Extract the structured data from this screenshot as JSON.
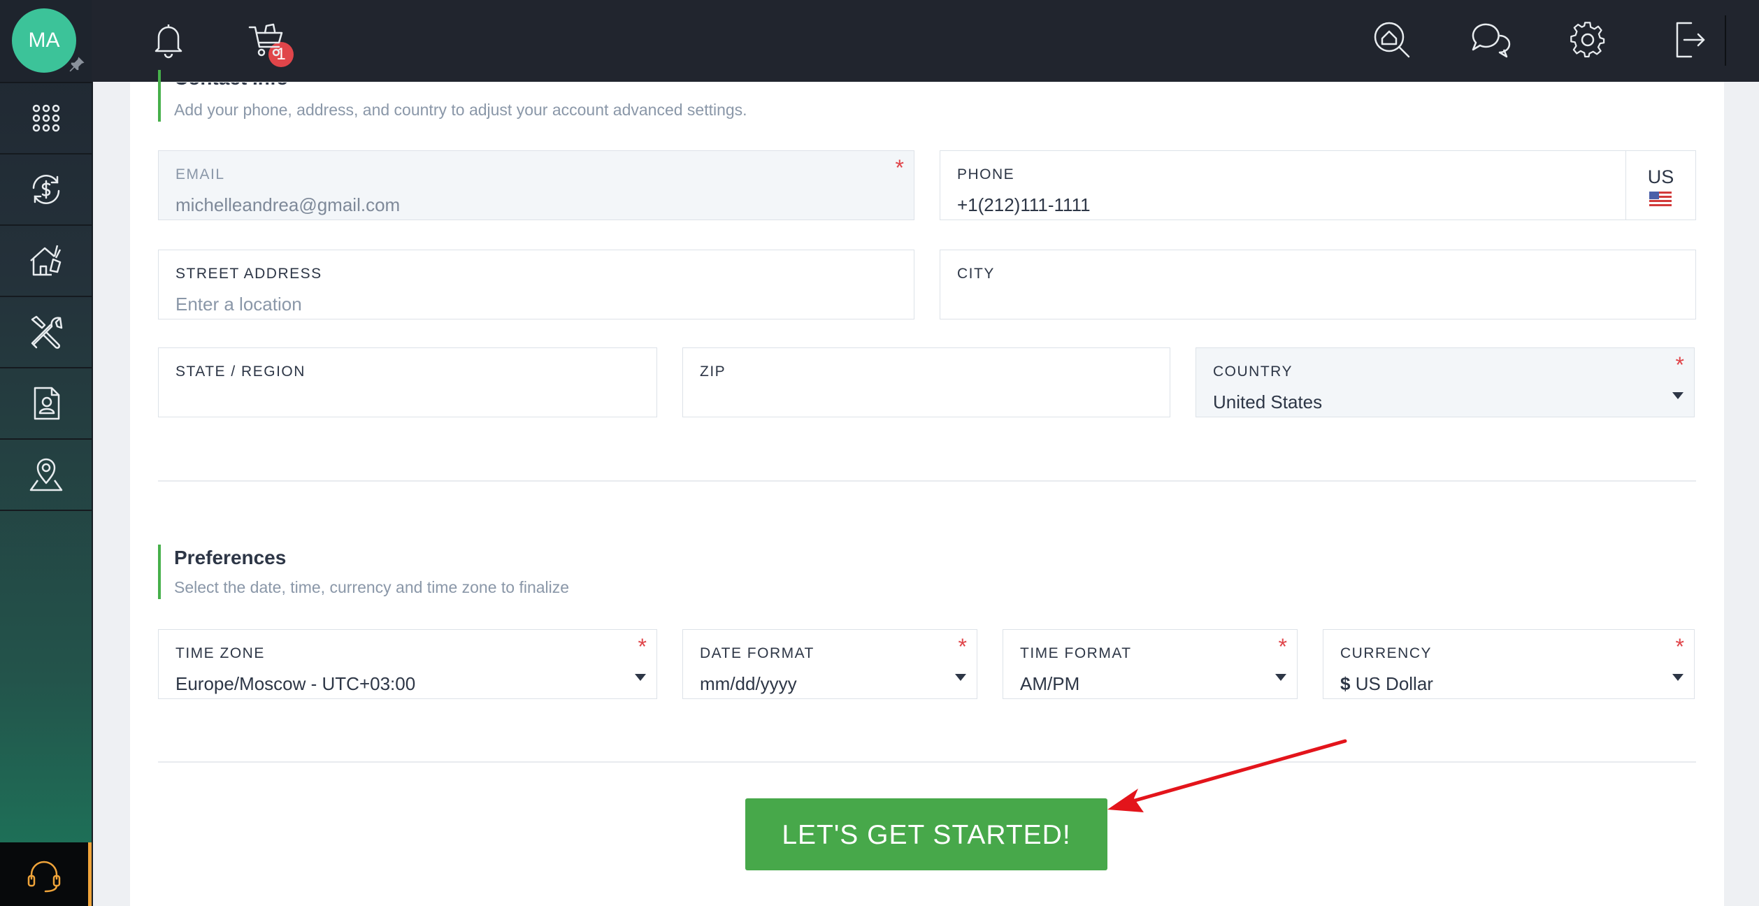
{
  "user": {
    "initials": "MA"
  },
  "topbar": {
    "notification_count": "1"
  },
  "contact": {
    "title": "Contact Info",
    "subtitle": "Add your phone, address, and country to adjust your account advanced settings.",
    "email": {
      "label": "EMAIL",
      "value": "michelleandrea@gmail.com",
      "required": "*"
    },
    "phone": {
      "label": "PHONE",
      "value": "+1(212)111-1111",
      "country_code": "US"
    },
    "street": {
      "label": "STREET ADDRESS",
      "placeholder": "Enter a location"
    },
    "city": {
      "label": "CITY",
      "value": ""
    },
    "state": {
      "label": "STATE / REGION",
      "value": ""
    },
    "zip": {
      "label": "ZIP",
      "value": ""
    },
    "country": {
      "label": "COUNTRY",
      "value": "United States",
      "required": "*"
    }
  },
  "preferences": {
    "title": "Preferences",
    "subtitle": "Select the date, time, currency and time zone to finalize",
    "timezone": {
      "label": "TIME ZONE",
      "value": "Europe/Moscow - UTC+03:00",
      "required": "*"
    },
    "date_format": {
      "label": "DATE FORMAT",
      "value": "mm/dd/yyyy",
      "required": "*"
    },
    "time_format": {
      "label": "TIME FORMAT",
      "value": "AM/PM",
      "required": "*"
    },
    "currency": {
      "label": "CURRENCY",
      "symbol": "$",
      "value": "US Dollar",
      "required": "*"
    }
  },
  "cta": {
    "label": "LET'S GET STARTED!"
  },
  "colors": {
    "accent": "#47a84a",
    "required": "#e0454a",
    "topbar": "#21252e",
    "avatar": "#3cc399",
    "annotation_arrow": "#e3141b"
  }
}
